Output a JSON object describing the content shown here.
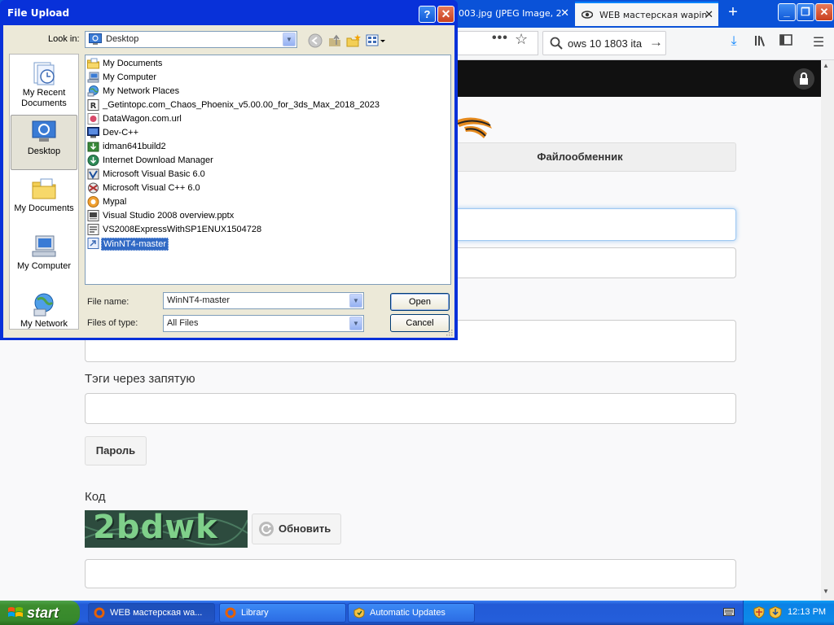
{
  "browser": {
    "tabs": [
      {
        "label": "003.jpg (JPEG Image, 2"
      },
      {
        "label": "WEB мастерская wapin"
      }
    ],
    "search_text": "ows 10 1803 ita"
  },
  "page": {
    "file_sharing_tab": "Файлообменник",
    "tags_label": "Тэги через запятую",
    "password_button": "Пароль",
    "code_label": "Код",
    "captcha_text": "2bdwk",
    "refresh_button": "Обновить"
  },
  "dialog": {
    "title": "File Upload",
    "look_in_label": "Look in:",
    "look_in_value": "Desktop",
    "places": [
      {
        "label": "My Recent Documents",
        "icon": "recent-documents-icon"
      },
      {
        "label": "Desktop",
        "icon": "desktop-icon",
        "selected": true
      },
      {
        "label": "My Documents",
        "icon": "my-documents-icon"
      },
      {
        "label": "My Computer",
        "icon": "my-computer-icon"
      },
      {
        "label": "My Network",
        "icon": "my-network-icon"
      }
    ],
    "files": [
      {
        "name": "My Documents",
        "icon": "folder-icon"
      },
      {
        "name": "My Computer",
        "icon": "computer-icon"
      },
      {
        "name": "My Network Places",
        "icon": "network-icon"
      },
      {
        "name": "_Getintopc.com_Chaos_Phoenix_v5.00.00_for_3ds_Max_2018_2023",
        "icon": "rar-icon"
      },
      {
        "name": "DataWagon.com.url",
        "icon": "url-icon"
      },
      {
        "name": "Dev-C++",
        "icon": "devcpp-icon"
      },
      {
        "name": "idman641build2",
        "icon": "installer-icon"
      },
      {
        "name": "Internet Download Manager",
        "icon": "idm-icon"
      },
      {
        "name": "Microsoft Visual Basic 6.0",
        "icon": "vb-icon"
      },
      {
        "name": "Microsoft Visual C++ 6.0",
        "icon": "vc-icon"
      },
      {
        "name": "Mypal",
        "icon": "mypal-icon"
      },
      {
        "name": "Visual Studio 2008 overview.pptx",
        "icon": "pptx-icon"
      },
      {
        "name": "VS2008ExpressWithSP1ENUX1504728",
        "icon": "iso-icon"
      },
      {
        "name": "WinNT4-master",
        "icon": "folder-shortcut-icon",
        "selected": true
      }
    ],
    "file_name_label": "File name:",
    "file_name_value": "WinNT4-master",
    "files_of_type_label": "Files of type:",
    "files_of_type_value": "All Files",
    "open_button": "Open",
    "cancel_button": "Cancel"
  },
  "taskbar": {
    "start_label": "start",
    "tasks": [
      {
        "label": "WEB мастерская wa...",
        "icon": "firefox-icon",
        "active": true
      },
      {
        "label": "Library",
        "icon": "library-icon"
      },
      {
        "label": "Automatic Updates",
        "icon": "automatic-updates-icon"
      }
    ],
    "clock": "12:13 PM"
  },
  "colors": {
    "xp_title_blue": "#0831d9",
    "xp_face": "#ece9d8",
    "selection_blue": "#316ac5",
    "start_green": "#3c8d2e",
    "firefox_accent": "#0a84ff"
  }
}
